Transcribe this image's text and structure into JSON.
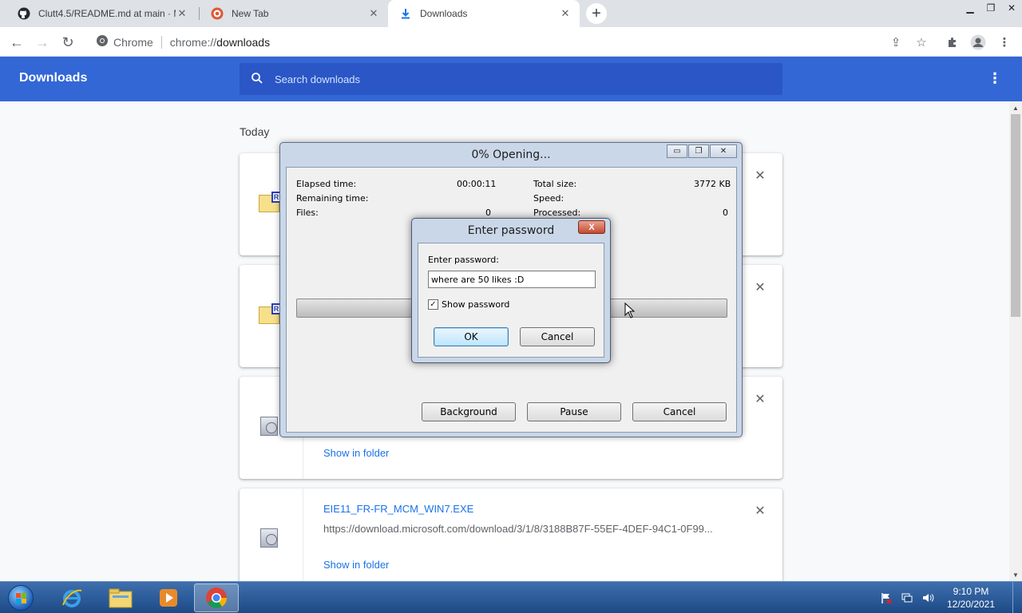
{
  "browser": {
    "tabs": [
      {
        "title": "Clutt4.5/README.md at main · M",
        "active": false
      },
      {
        "title": "New Tab",
        "active": false
      },
      {
        "title": "Downloads",
        "active": true
      }
    ],
    "omnibox": {
      "chip": "Chrome",
      "scheme": "chrome://",
      "host": "downloads"
    }
  },
  "downloads": {
    "title": "Downloads",
    "search_placeholder": "Search downloads",
    "section": "Today",
    "items": [
      {
        "name": "",
        "url": "",
        "show_folder": ""
      },
      {
        "name": "",
        "url": "",
        "show_folder": ""
      },
      {
        "name": "",
        "url": "",
        "show_folder": "Show in folder"
      },
      {
        "name": "EIE11_FR-FR_MCM_WIN7.EXE",
        "url": "https://download.microsoft.com/download/3/1/8/3188B87F-55EF-4DEF-94C1-0F99...",
        "show_folder": "Show in folder"
      }
    ]
  },
  "progress_dialog": {
    "title": "0% Opening...",
    "elapsed_label": "Elapsed time:",
    "elapsed_value": "00:00:11",
    "remaining_label": "Remaining time:",
    "files_label": "Files:",
    "files_value": "0",
    "total_size_label": "Total size:",
    "total_size_value": "3772 KB",
    "speed_label": "Speed:",
    "processed_label": "Processed:",
    "processed_value": "0",
    "progress_fraction": 0,
    "buttons": {
      "background": "Background",
      "pause": "Pause",
      "cancel": "Cancel"
    }
  },
  "password_dialog": {
    "title": "Enter password",
    "close_glyph": "X",
    "label": "Enter password:",
    "value": "where are 50 likes :D",
    "show_password_label": "Show password",
    "show_password_checked": true,
    "ok": "OK",
    "cancel": "Cancel"
  },
  "taskbar": {
    "time": "9:10 PM",
    "date": "12/20/2021"
  },
  "colors": {
    "header_blue": "#3367d6",
    "link_blue": "#1a73e8"
  }
}
